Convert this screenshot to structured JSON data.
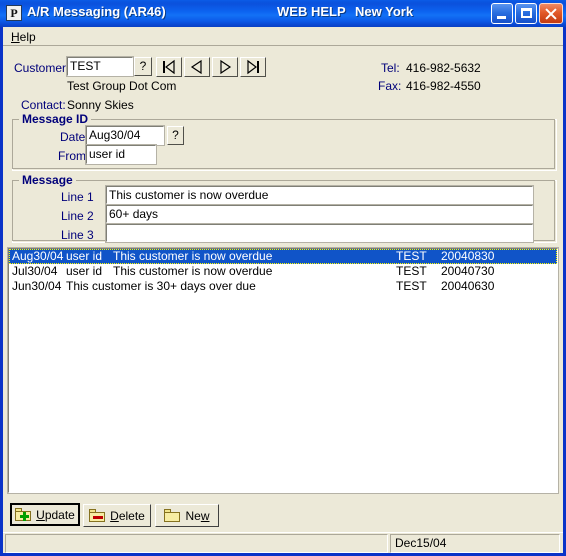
{
  "window": {
    "title": "A/R Messaging (AR46)",
    "web_help": "WEB HELP",
    "region": "New York",
    "icon": "app-icon-p",
    "icon_glyph": "P",
    "controls": {
      "minimize": "minimize-button",
      "maximize": "maximize-button",
      "close": "close-button"
    },
    "colors": {
      "titlebar_blue": "#0c5ce8",
      "face": "#ece9d8",
      "label_blue": "#00007a",
      "selection_blue": "#1054c8",
      "close_red": "#e25a2a"
    }
  },
  "menu": {
    "items": [
      {
        "label": "Help",
        "accel": "H"
      }
    ]
  },
  "customer": {
    "label": "Customer",
    "value": "TEST",
    "placeholder": "",
    "lookup_button": "?",
    "name": "Test Group Dot Com",
    "contact_label": "Contact:",
    "contact_value": "Sonny Skies",
    "nav": [
      {
        "name": "first-record",
        "glyph": "|<"
      },
      {
        "name": "previous-record",
        "glyph": "<"
      },
      {
        "name": "next-record",
        "glyph": ">"
      },
      {
        "name": "last-record",
        "glyph": ">|"
      }
    ]
  },
  "contact_info": {
    "tel_label": "Tel:",
    "tel_value": "416-982-5632",
    "fax_label": "Fax:",
    "fax_value": "416-982-4550"
  },
  "message_id": {
    "title": "Message ID",
    "date_label": "Date",
    "date_value": "Aug30/04",
    "date_lookup": "?",
    "from_label": "From",
    "from_value": "user id"
  },
  "message": {
    "title": "Message",
    "lines": [
      {
        "label": "Line 1",
        "value": "This customer is now overdue"
      },
      {
        "label": "Line 2",
        "value": "60+ days"
      },
      {
        "label": "Line 3",
        "value": ""
      }
    ]
  },
  "list": {
    "rows": [
      {
        "date": "Aug30/04",
        "user": "user id",
        "text": "This customer is now overdue",
        "customer": "TEST",
        "key": "20040830",
        "selected": true
      },
      {
        "date": "Jul30/04",
        "user": "user id",
        "text": "This customer is now overdue",
        "customer": "TEST",
        "key": "20040730",
        "selected": false
      },
      {
        "date": "Jun30/04",
        "user": "",
        "text": "This customer is 30+ days over due",
        "customer": "TEST",
        "key": "20040630",
        "selected": false
      }
    ]
  },
  "actions": {
    "update": {
      "label": "Update",
      "accel": "U",
      "icon": "folder-add-icon"
    },
    "delete": {
      "label": "Delete",
      "accel": "D",
      "icon": "folder-remove-icon"
    },
    "new": {
      "label": "New",
      "accel": "w",
      "icon": "folder-icon"
    }
  },
  "statusbar": {
    "left_text": "",
    "date": "Dec15/04"
  }
}
